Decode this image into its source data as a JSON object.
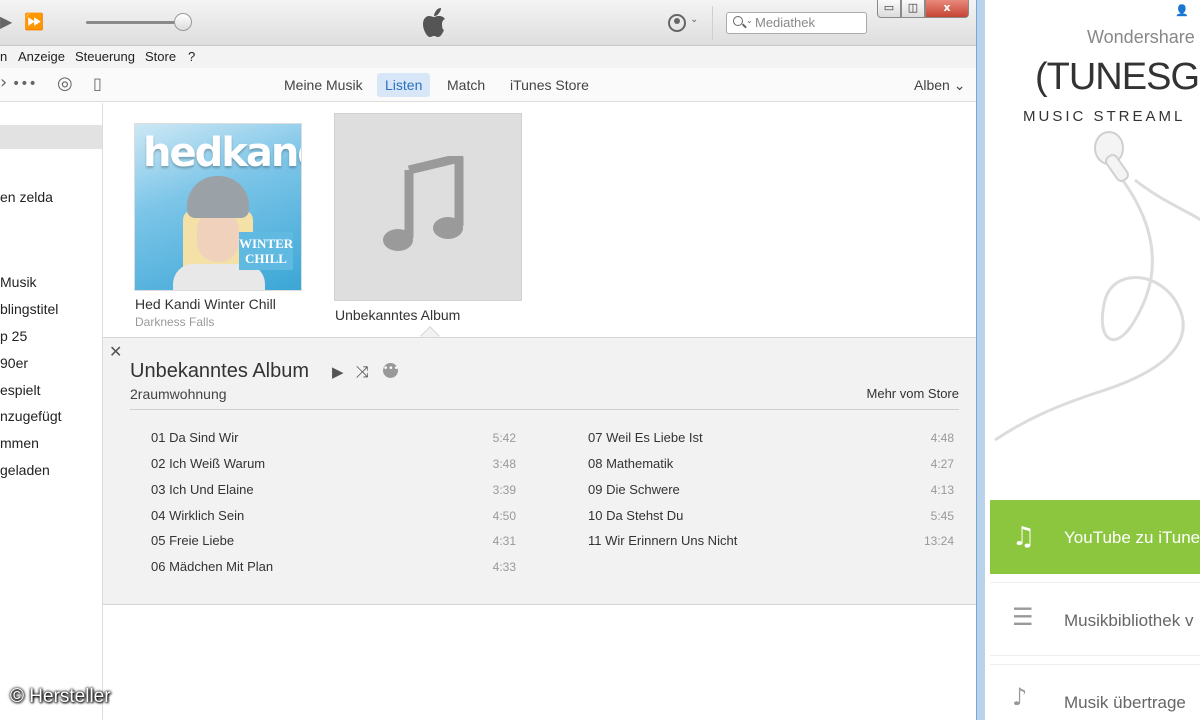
{
  "titlebar": {
    "play_icon": "play-icon",
    "forward_icon": "forward-icon",
    "volume_level": 0.9,
    "search_placeholder": "Mediathek",
    "window_buttons": {
      "minimize": "▭",
      "restore": "◫",
      "close": "x"
    }
  },
  "menu": {
    "items": [
      "n",
      "Anzeige",
      "Steuerung",
      "Store",
      "?"
    ]
  },
  "nav": {
    "tabs": [
      "Meine Musik",
      "Listen",
      "Match",
      "iTunes Store"
    ],
    "active_tab": "Listen",
    "view_select": "Alben ⌄"
  },
  "sidebar": {
    "items": [
      "en zelda",
      "Musik",
      "blingstitel",
      "p 25",
      "90er",
      "espielt",
      "nzugefügt",
      "mmen",
      "geladen"
    ]
  },
  "albums": [
    {
      "title": "Hed Kandi Winter Chill",
      "artist": "Darkness Falls",
      "cover_logo": "hedkandi",
      "cover_tag": "WINTER CHILL"
    },
    {
      "title": "Unbekanntes Album",
      "artist": ""
    }
  ],
  "detail": {
    "title": "Unbekanntes Album",
    "artist": "2raumwohnung",
    "store_link": "Mehr vom Store",
    "close": "✕",
    "tracks": [
      {
        "label": "01 Da Sind Wir",
        "time": "5:42"
      },
      {
        "label": "02 Ich Weiß Warum",
        "time": "3:48"
      },
      {
        "label": "03 Ich Und Elaine",
        "time": "3:39"
      },
      {
        "label": "04 Wirklich Sein",
        "time": "4:50"
      },
      {
        "label": "05 Freie Liebe",
        "time": "4:31"
      },
      {
        "label": "06 Mädchen Mit Plan",
        "time": "4:33"
      },
      {
        "label": "07 Weil Es Liebe Ist",
        "time": "4:48"
      },
      {
        "label": "08 Mathematik",
        "time": "4:27"
      },
      {
        "label": "09 Die Schwere",
        "time": "4:13"
      },
      {
        "label": "10 Da Stehst Du",
        "time": "5:45"
      },
      {
        "label": "11 Wir Erinnern Uns Nicht",
        "time": "13:24"
      }
    ]
  },
  "tunesgo": {
    "brand": "Wondershare",
    "logo": "(TUNESG",
    "subtitle": "MUSIC STREAML",
    "buttons": [
      {
        "label": "YouTube zu iTune",
        "icon": "music-add-icon",
        "color": "#8cc63f"
      },
      {
        "label": "Musikbibliothek v",
        "icon": "library-icon"
      },
      {
        "label": "Musik übertrage",
        "icon": "transfer-music-icon"
      }
    ]
  },
  "watermark": "© Hersteller",
  "colors": {
    "accent": "#2c6fc0",
    "tab_active_bg": "#d8e7f7",
    "tunesgo_green": "#8cc63f"
  }
}
